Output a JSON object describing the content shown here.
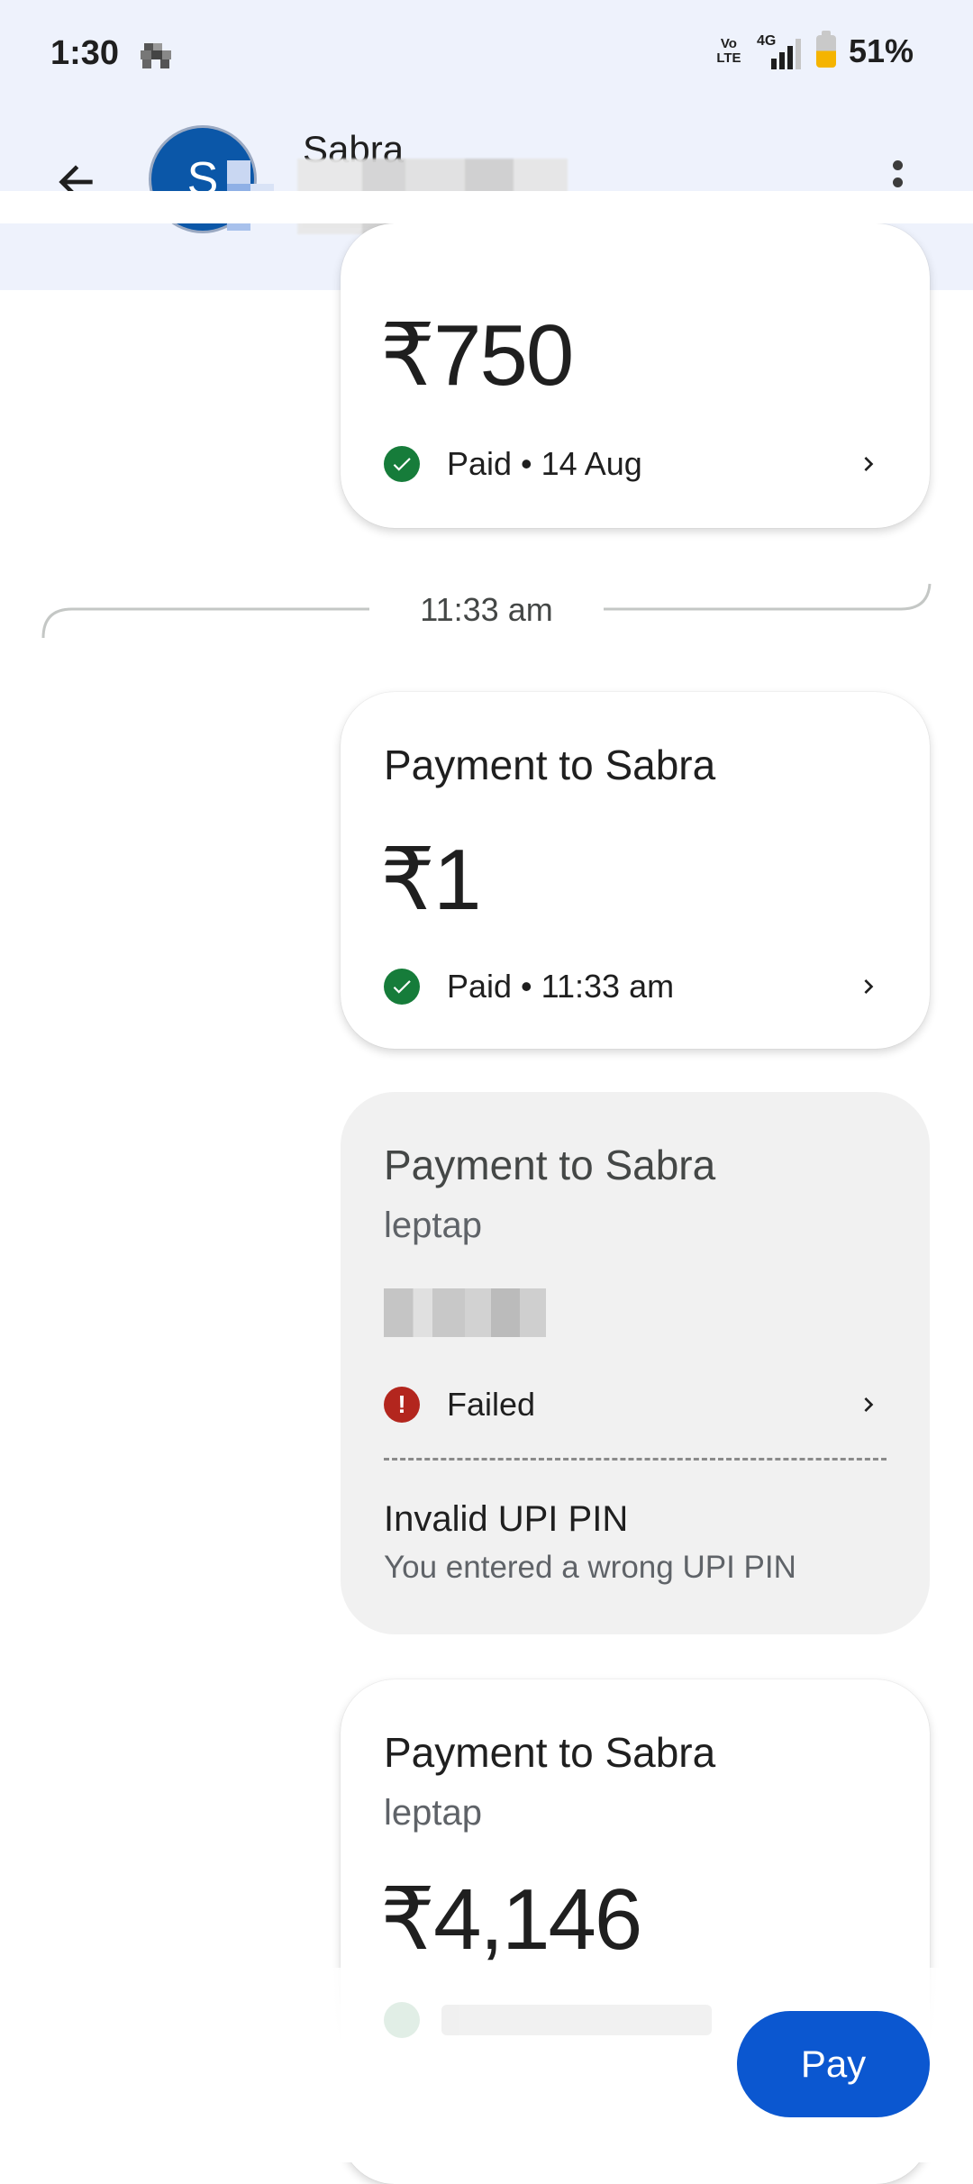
{
  "status_bar": {
    "time": "1:30",
    "network_badge": "Vo\nLTE",
    "network_type": "4G",
    "battery": "51%"
  },
  "header": {
    "avatar_letter": "S",
    "contact_name": "Sabra",
    "contact_sub_visible": "mbk"
  },
  "cards": [
    {
      "amount": "₹750",
      "status": "Paid • 14 Aug"
    },
    {
      "title": "Payment to Sabra",
      "amount": "₹1",
      "status": "Paid • 11:33 am"
    },
    {
      "title": "Payment to Sabra",
      "subtitle": "leptap",
      "status": "Failed",
      "error_title": "Invalid UPI PIN",
      "error_desc": "You entered a wrong UPI PIN"
    },
    {
      "title": "Payment to Sabra",
      "subtitle": "leptap",
      "amount": "₹4,146"
    }
  ],
  "divider_time": "11:33 am",
  "pay_button": "Pay",
  "colors": {
    "header_bg": "#eef2fc",
    "accent": "#0b57d0",
    "success": "#167c3a",
    "error": "#b3261e",
    "failed_card_bg": "#f1f1f1"
  }
}
